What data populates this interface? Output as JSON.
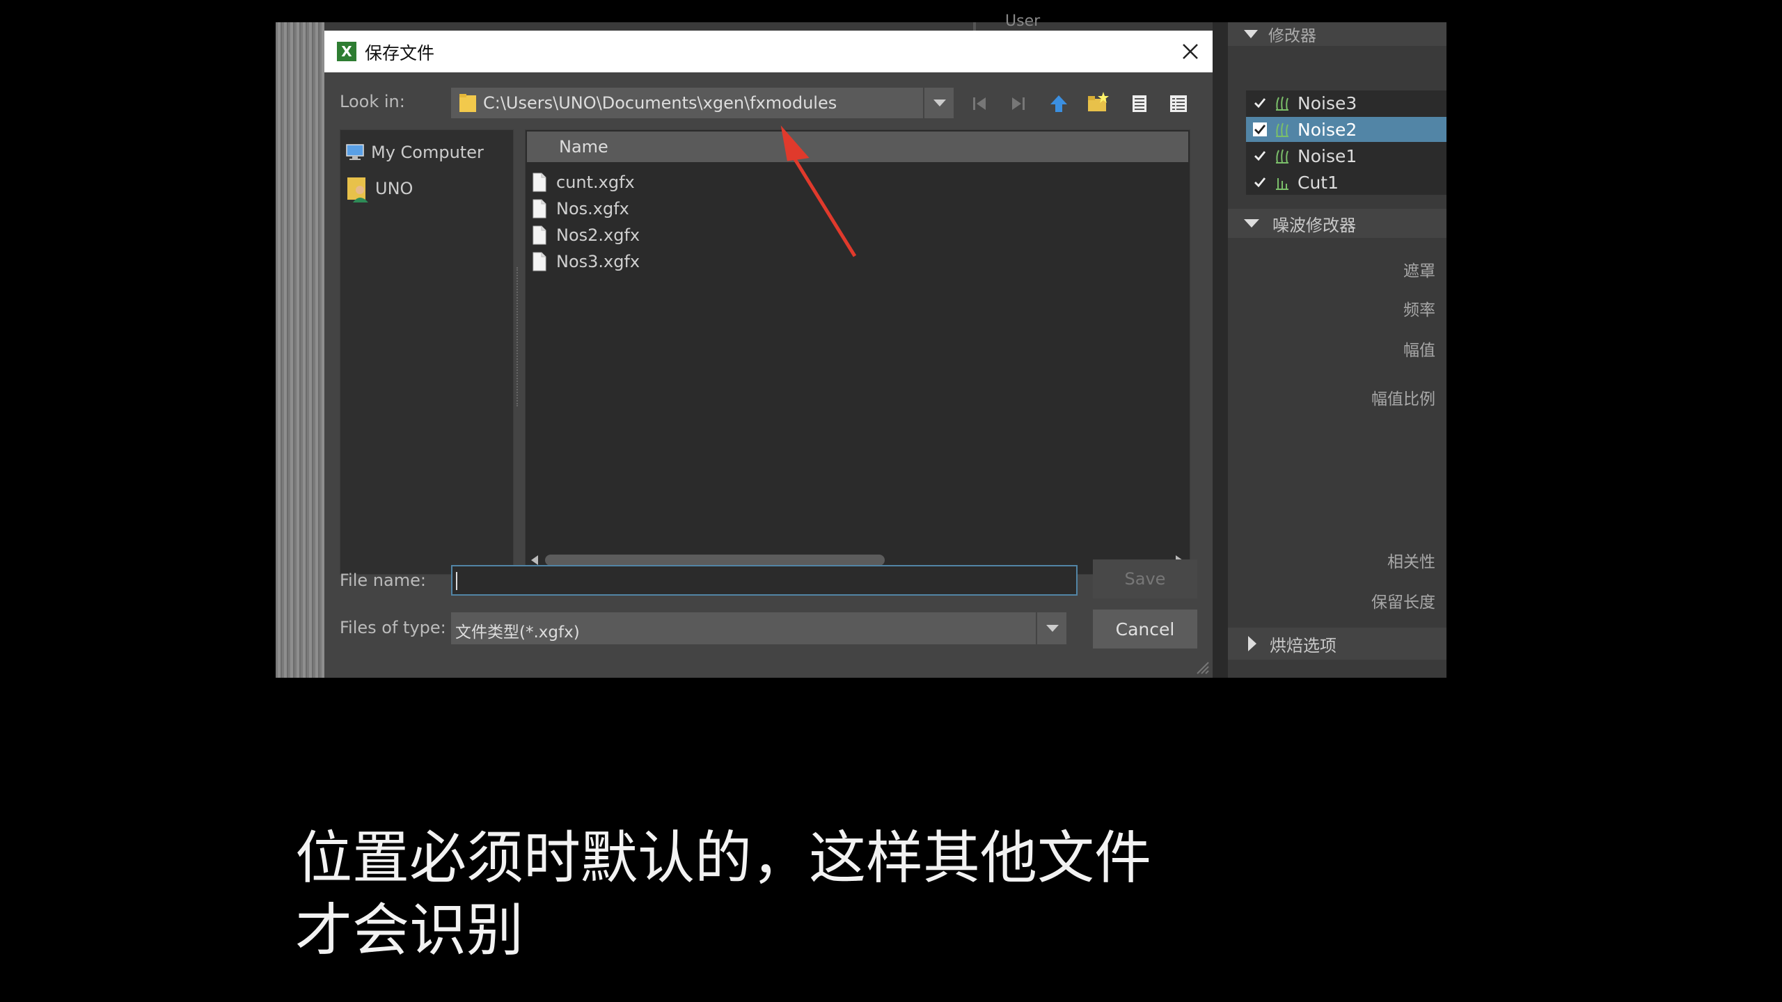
{
  "dialog": {
    "title": "保存文件",
    "app_icon_letter": "X",
    "look_in_label": "Look in:",
    "look_in_path": "C:\\Users\\UNO\\Documents\\xgen\\fxmodules",
    "sidebar": [
      {
        "label": "My Computer",
        "icon": "computer-icon"
      },
      {
        "label": "UNO",
        "icon": "user-folder-icon"
      }
    ],
    "column_header": "Name",
    "files": [
      "cunt.xgfx",
      "Nos.xgfx",
      "Nos2.xgfx",
      "Nos3.xgfx"
    ],
    "file_name_label": "File name:",
    "file_name_value": "",
    "files_of_type_label": "Files of type:",
    "files_of_type_value": "文件类型(*.xgfx)",
    "save_label": "Save",
    "cancel_label": "Cancel"
  },
  "background": {
    "user_label": "User"
  },
  "right_panel": {
    "top_section": "修改器",
    "modifiers": [
      {
        "name": "Noise3",
        "checked": true,
        "selected": false
      },
      {
        "name": "Noise2",
        "checked": true,
        "selected": true
      },
      {
        "name": "Noise1",
        "checked": true,
        "selected": false
      },
      {
        "name": "Cut1",
        "checked": true,
        "selected": false
      }
    ],
    "noise_section": "噪波修改器",
    "properties": [
      "遮罩",
      "频率",
      "幅值",
      "幅值比例",
      "相关性",
      "保留长度"
    ],
    "bake_section": "烘焙选项"
  },
  "subtitle": {
    "line1": "位置必须时默认的，这样其他文件",
    "line2": "才会识别"
  },
  "colors": {
    "selection": "#5285a6",
    "arrow": "#e03a2c",
    "dialog_bg": "#444444"
  }
}
